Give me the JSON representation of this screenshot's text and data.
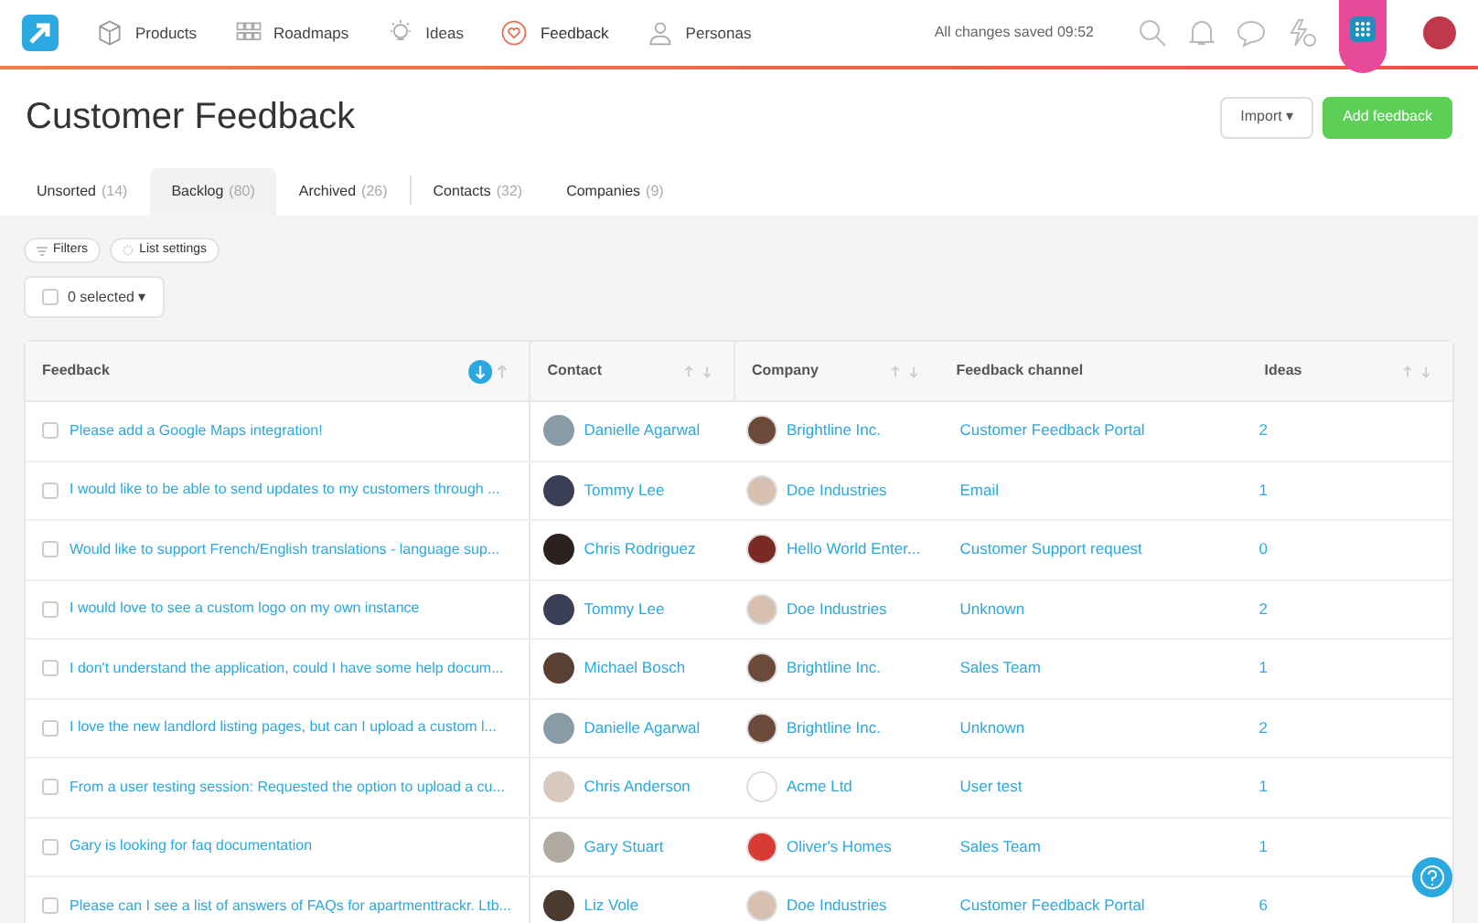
{
  "nav": {
    "items": [
      {
        "label": "Products",
        "kind": "box",
        "selected": false
      },
      {
        "label": "Roadmaps",
        "kind": "grid",
        "selected": false
      },
      {
        "label": "Ideas",
        "kind": "bulb",
        "selected": false
      },
      {
        "label": "Feedback",
        "kind": "heart",
        "selected": true
      },
      {
        "label": "Personas",
        "kind": "person",
        "selected": false
      }
    ],
    "save_status": "All changes saved 09:52"
  },
  "page": {
    "title": "Customer Feedback",
    "buttons": [
      {
        "label": "Import ▾",
        "kind": "secondary"
      },
      {
        "label": "Add feedback",
        "kind": "primary"
      }
    ]
  },
  "tabs": [
    {
      "label": "Unsorted",
      "count": "(14)",
      "selected": false
    },
    {
      "label": "Backlog",
      "count": "(80)",
      "selected": true
    },
    {
      "label": "Archived",
      "count": "(26)",
      "selected": false
    },
    {
      "label": "Contacts",
      "count": "(32)",
      "selected": false
    },
    {
      "label": "Companies",
      "count": "(9)",
      "selected": false
    }
  ],
  "toolbar": {
    "filters": "Filters",
    "list_settings": "List settings",
    "selection": {
      "label": "0 selected ▾",
      "checked": false
    }
  },
  "table": {
    "columns": [
      {
        "label": "Feedback",
        "sorted": true
      },
      {
        "label": "Contact",
        "sorted": false
      },
      {
        "label": "Company",
        "sorted": false
      },
      {
        "label": "Feedback channel"
      },
      {
        "label": "Ideas",
        "sorted": false
      }
    ],
    "rows": [
      {
        "feedback": "Please add a Google Maps integration!",
        "contact": "Danielle Agarwal",
        "company": "Brightline Inc.",
        "channel": "Customer Feedback Portal",
        "ideas": "2",
        "checked": false
      },
      {
        "feedback": "I would like to be able to send updates to my customers through ...",
        "contact": "Tommy Lee",
        "company": "Doe Industries",
        "channel": "Email",
        "ideas": "1",
        "checked": false
      },
      {
        "feedback": "Would like to support French/English translations - language sup...",
        "contact": "Chris Rodriguez",
        "company": "Hello World Enter...",
        "channel": "Customer Support request",
        "ideas": "0",
        "checked": false
      },
      {
        "feedback": "I would love to see a custom logo on my own instance",
        "contact": "Tommy Lee",
        "company": "Doe Industries",
        "channel": "Unknown",
        "ideas": "2",
        "checked": false
      },
      {
        "feedback": "I don't understand the application, could I have some help docum...",
        "contact": "Michael Bosch",
        "company": "Brightline Inc.",
        "channel": "Sales Team",
        "ideas": "1",
        "checked": false
      },
      {
        "feedback": "I love the new landlord listing pages, but can I upload a custom l...",
        "contact": "Danielle Agarwal",
        "company": "Brightline Inc.",
        "channel": "Unknown",
        "ideas": "2",
        "checked": false
      },
      {
        "feedback": "From a user testing session: Requested the option to upload a cu...",
        "contact": "Chris Anderson",
        "company": "Acme Ltd",
        "channel": "User test",
        "ideas": "1",
        "checked": false
      },
      {
        "feedback": "Gary is looking for faq documentation",
        "contact": "Gary Stuart",
        "company": "Oliver's Homes",
        "channel": "Sales Team",
        "ideas": "1",
        "checked": false
      },
      {
        "feedback": "Please can I see a list of answers of FAQs for apartmenttrackr. Ltb...",
        "contact": "Liz Vole",
        "company": "Doe Industries",
        "channel": "Customer Feedback Portal",
        "ideas": "6",
        "checked": false
      }
    ]
  }
}
